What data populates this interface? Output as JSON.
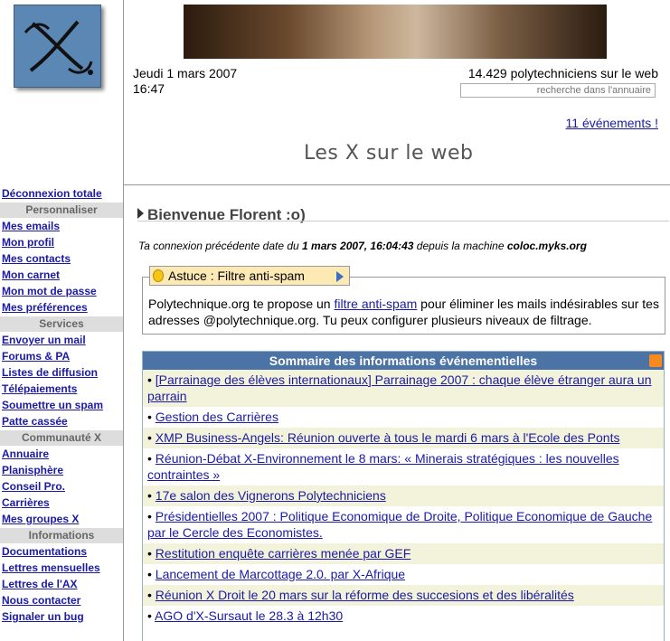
{
  "header": {
    "date": "Jeudi 1 mars 2007",
    "time": "16:47",
    "counter": "14.429 polytechniciens sur le web",
    "search_placeholder": "recherche dans l'annuaire",
    "events_link": "11 événements !",
    "site_title": "Les X sur le web"
  },
  "sidebar": {
    "top_link": "Déconnexion totale",
    "sections": [
      {
        "title": "Personnaliser",
        "links": [
          "Mes emails",
          "Mon profil",
          "Mes contacts",
          "Mon carnet",
          "Mon mot de passe",
          "Mes préférences"
        ]
      },
      {
        "title": "Services",
        "links": [
          "Envoyer un mail",
          "Forums & PA",
          "Listes de diffusion",
          "Télépaiements",
          "Soumettre un spam",
          "Patte cassée"
        ]
      },
      {
        "title": "Communauté X",
        "links": [
          "Annuaire",
          "Planisphère",
          "Conseil Pro.",
          "Carrières",
          "Mes groupes X"
        ]
      },
      {
        "title": "Informations",
        "links": [
          "Documentations",
          "Lettres mensuelles",
          "Lettres de l'AX",
          "Nous contacter",
          "Signaler un bug"
        ]
      }
    ]
  },
  "main": {
    "welcome": "Bienvenue Florent :o)",
    "last_conn_prefix": "Ta connexion précédente date du ",
    "last_conn_date": "1 mars 2007, 16:04:43",
    "last_conn_mid": " depuis la machine ",
    "last_conn_host": "coloc.myks.org",
    "tip_title": "Astuce : Filtre anti-spam",
    "tip_text_pre": "Polytechnique.org te propose un ",
    "tip_link": "filtre anti-spam",
    "tip_text_post": " pour éliminer les mails indésirables sur tes adresses @polytechnique.org. Tu peux configurer plusieurs niveaux de filtrage.",
    "events_header": "Sommaire des informations événementielles",
    "events": [
      "[Parrainage des élèves internationaux] Parrainage 2007 : chaque élève étranger aura un parrain",
      "Gestion des Carrières",
      "XMP Business-Angels: Réunion ouverte à tous le mardi 6 mars à l'Ecole des Ponts",
      "Réunion-Débat X-Environnement le 8 mars: « Minerais stratégiques : les nouvelles contraintes »",
      "17e salon des Vignerons Polytechniciens",
      "Présidentielles 2007 : Politique Economique de Droite, Politique Economique de Gauche par le Cercle des Economistes.",
      "Restitution enquête carrières menée par GEF",
      "Lancement de Marcottage 2.0. par X-Afrique",
      "Réunion X Droit le 20 mars sur la réforme des succesions et des libéralités",
      "AGO d'X-Sursaut le 28.3 à 12h30"
    ]
  },
  "colors": {
    "link": "#1a1aa6",
    "header_blue": "#4b73a6",
    "logo_blue": "#5b87b5",
    "tip_bg": "#fde9b4"
  },
  "icons": [
    "x-logo-icon",
    "bulb-icon",
    "arrow-right-icon",
    "rss-icon"
  ]
}
